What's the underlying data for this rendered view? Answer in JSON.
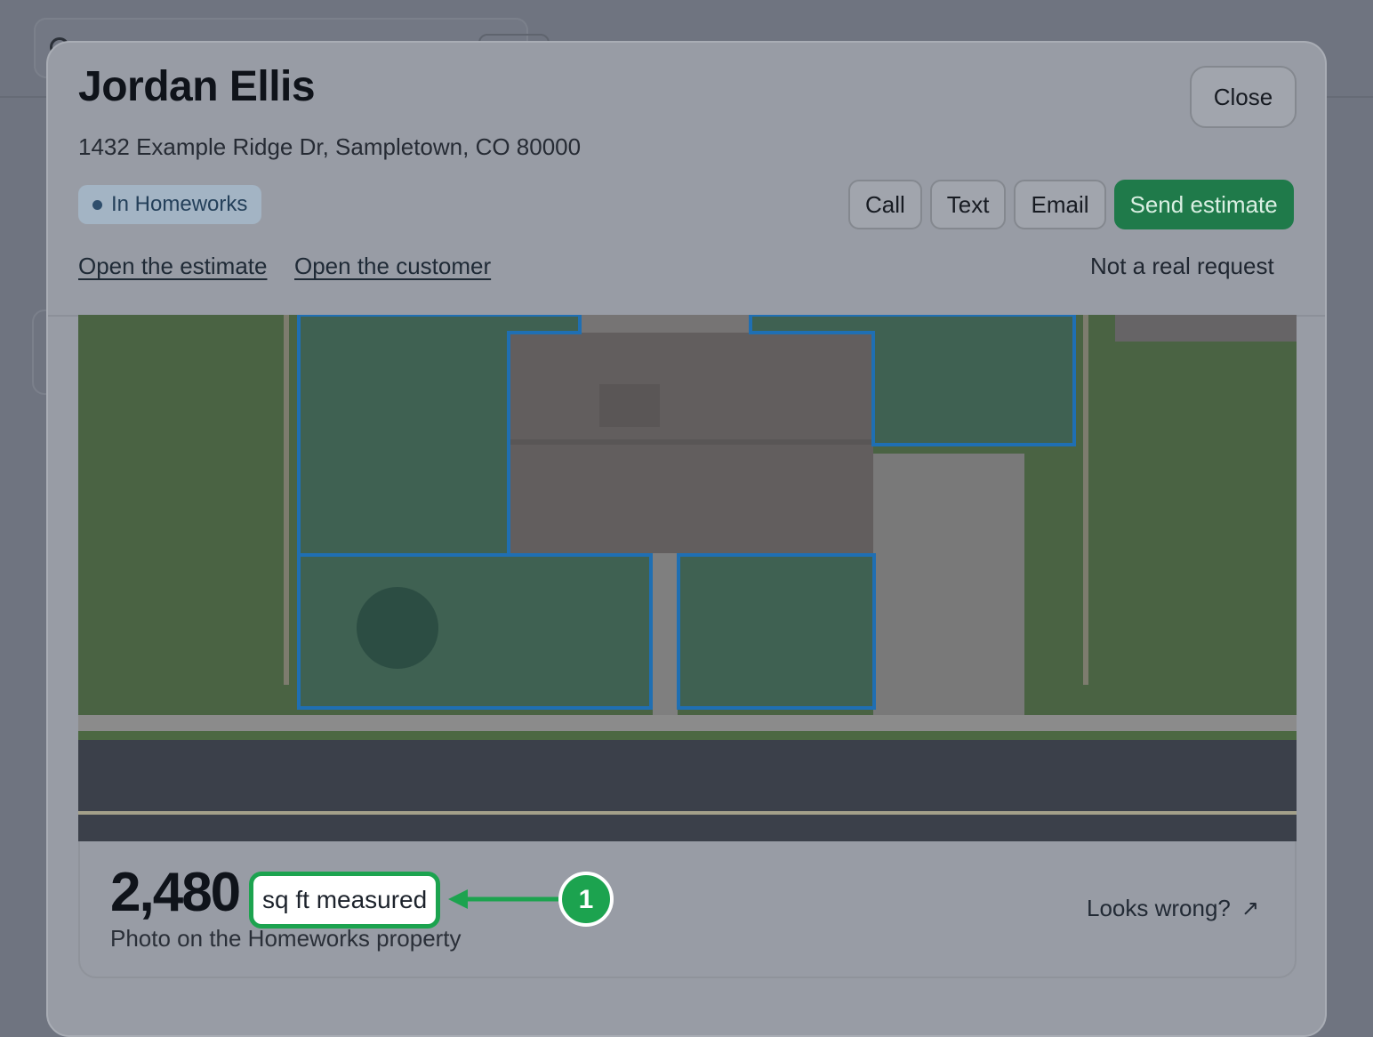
{
  "modal": {
    "title": "Jordan Ellis",
    "address": "1432 Example Ridge Dr, Sampletown, CO 80000",
    "status_badge": "In Homeworks",
    "close_label": "Close",
    "actions": {
      "call": "Call",
      "text": "Text",
      "email": "Email",
      "send_estimate": "Send estimate"
    },
    "links": {
      "open_estimate": "Open the estimate",
      "open_customer": "Open the customer",
      "not_real": "Not a real request"
    },
    "measurement": {
      "value": "2,480",
      "unit": "sq ft measured",
      "caption": "Photo on the Homeworks property",
      "looks_wrong": "Looks wrong?"
    }
  },
  "annotation": {
    "marker": "1",
    "color": "#1ca34f"
  },
  "icons": {
    "status": "dot-icon",
    "external": "arrow-up-right-icon",
    "map": "aerial-property-map"
  },
  "colors": {
    "primary": "#1f7a4a",
    "outline": "#1f6fb3"
  }
}
